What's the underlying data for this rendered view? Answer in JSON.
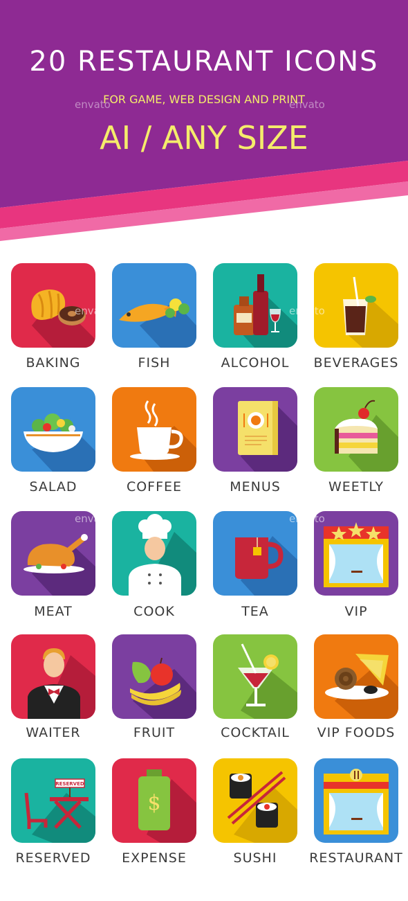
{
  "header": {
    "title": "20 RESTAURANT ICONS",
    "subtitle": "FOR GAME, WEB DESIGN AND PRINT",
    "size_line": "AI / ANY SIZE",
    "watermark": "envato"
  },
  "colors": {
    "header_purple": "#8e2a93",
    "band_pink": "#e8357f",
    "label_gray": "#3a3a3a"
  },
  "icons": [
    {
      "label": "BAKING",
      "bg": "#e02a4a",
      "icon": "croissant-donut-icon"
    },
    {
      "label": "FISH",
      "bg": "#3a8fd8",
      "icon": "fish-icon"
    },
    {
      "label": "ALCOHOL",
      "bg": "#1ab3a0",
      "icon": "bottles-icon"
    },
    {
      "label": "BEVERAGES",
      "bg": "#f5c400",
      "icon": "soda-glass-icon"
    },
    {
      "label": "SALAD",
      "bg": "#3a8fd8",
      "icon": "salad-bowl-icon"
    },
    {
      "label": "COFFEE",
      "bg": "#f07a10",
      "icon": "coffee-cup-icon"
    },
    {
      "label": "MENUS",
      "bg": "#7b3fa0",
      "icon": "menu-book-icon"
    },
    {
      "label": "WEETLY",
      "bg": "#86c440",
      "icon": "cake-icon"
    },
    {
      "label": "MEAT",
      "bg": "#7b3fa0",
      "icon": "roast-chicken-icon"
    },
    {
      "label": "COOK",
      "bg": "#1ab3a0",
      "icon": "chef-icon"
    },
    {
      "label": "TEA",
      "bg": "#3a8fd8",
      "icon": "tea-mug-icon"
    },
    {
      "label": "VIP",
      "bg": "#7b3fa0",
      "icon": "vip-restaurant-icon"
    },
    {
      "label": "WAITER",
      "bg": "#e02a4a",
      "icon": "waiter-icon"
    },
    {
      "label": "FRUIT",
      "bg": "#7b3fa0",
      "icon": "fruit-icon"
    },
    {
      "label": "COCKTAIL",
      "bg": "#86c440",
      "icon": "cocktail-icon"
    },
    {
      "label": "VIP FOODS",
      "bg": "#f07a10",
      "icon": "vip-foods-icon"
    },
    {
      "label": "RESERVED",
      "bg": "#1ab3a0",
      "icon": "reserved-table-icon"
    },
    {
      "label": "EXPENSE",
      "bg": "#e02a4a",
      "icon": "money-jar-icon"
    },
    {
      "label": "SUSHI",
      "bg": "#f5c400",
      "icon": "sushi-icon"
    },
    {
      "label": "RESTAURANT",
      "bg": "#3a8fd8",
      "icon": "restaurant-icon"
    }
  ],
  "reserved_sign": "RESERVED",
  "expense_symbol": "$"
}
